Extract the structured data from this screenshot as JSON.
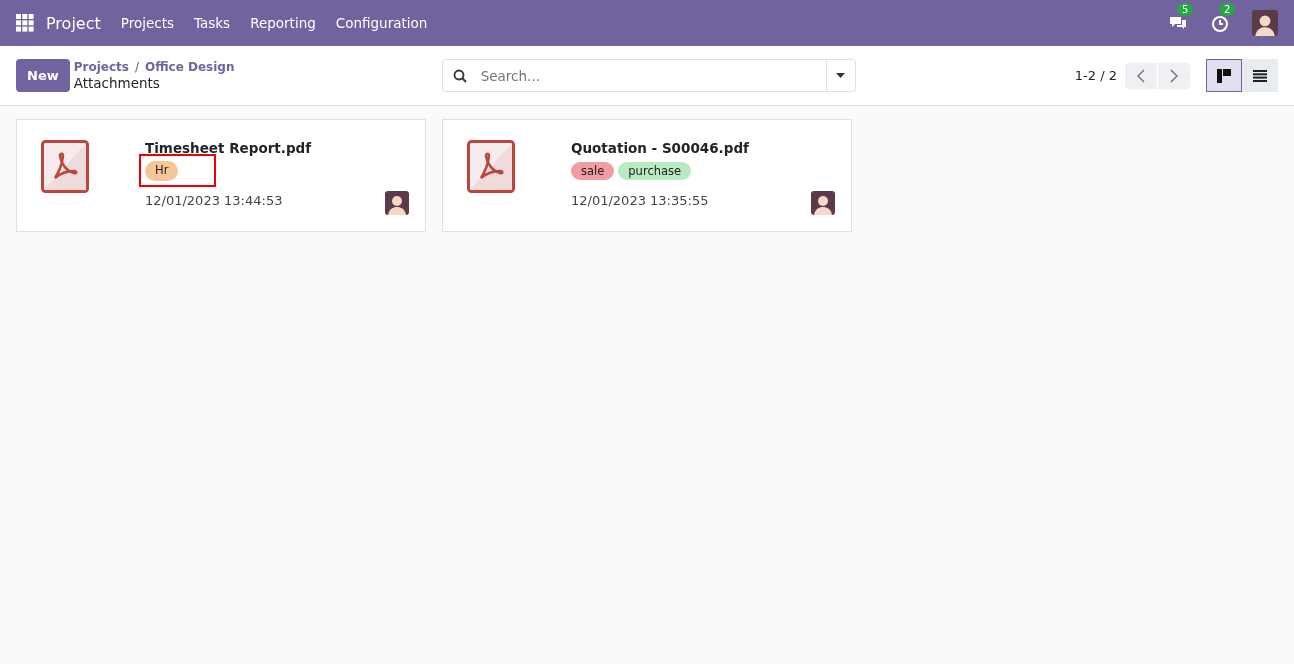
{
  "navbar": {
    "app_name": "Project",
    "menu": [
      "Projects",
      "Tasks",
      "Reporting",
      "Configuration"
    ],
    "messages_count": "5",
    "activities_count": "2"
  },
  "control_panel": {
    "new_button": "New",
    "breadcrumbs": [
      "Projects",
      "Office Design"
    ],
    "breadcrumb_separator": "/",
    "title": "Attachments",
    "search": {
      "placeholder": "Search..."
    },
    "pager": "1-2 / 2",
    "views": [
      {
        "kind": "kanban",
        "selected": true
      },
      {
        "kind": "list",
        "selected": false
      }
    ]
  },
  "cards": [
    {
      "name": "Timesheet Report.pdf",
      "date": "12/01/2023 13:44:53",
      "tags": [
        {
          "label": "Hr",
          "color": "#f8c596",
          "highlighted": true
        }
      ]
    },
    {
      "name": "Quotation - S00046.pdf",
      "date": "12/01/2023 13:35:55",
      "tags": [
        {
          "label": "sale",
          "color": "#f29c9f",
          "highlighted": false
        },
        {
          "label": "purchase",
          "color": "#b8ebc2",
          "highlighted": false
        }
      ]
    }
  ]
}
